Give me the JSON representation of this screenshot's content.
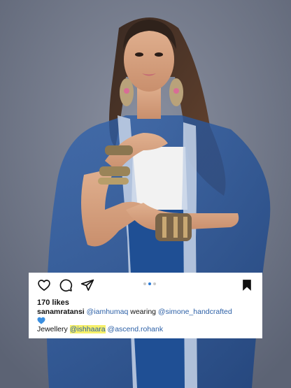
{
  "post": {
    "likes": "170 likes",
    "caption": {
      "username": "sanamratansi",
      "mention_1": "@iamhumaq",
      "text_wearing": " wearing ",
      "mention_2": "@simone_handcrafted",
      "emoji": "blue-heart",
      "jewellery_label": "Jewellery ",
      "mention_3": "@ishhaara",
      "mention_4": "@ascend.rohank"
    },
    "carousel": {
      "count": 3,
      "active_index": 1
    }
  },
  "icons": {
    "like": "heart-outline-icon",
    "comment": "comment-bubble-icon",
    "share": "paper-plane-icon",
    "save": "bookmark-filled-icon"
  },
  "colors": {
    "background": "#6f7686",
    "outfit_blue": "#1f4f94",
    "top_white": "#f2f2f2",
    "mention_blue": "#2b5fa6",
    "highlight_yellow": "#f6f06a",
    "heart_blue": "#3b8fe0"
  }
}
